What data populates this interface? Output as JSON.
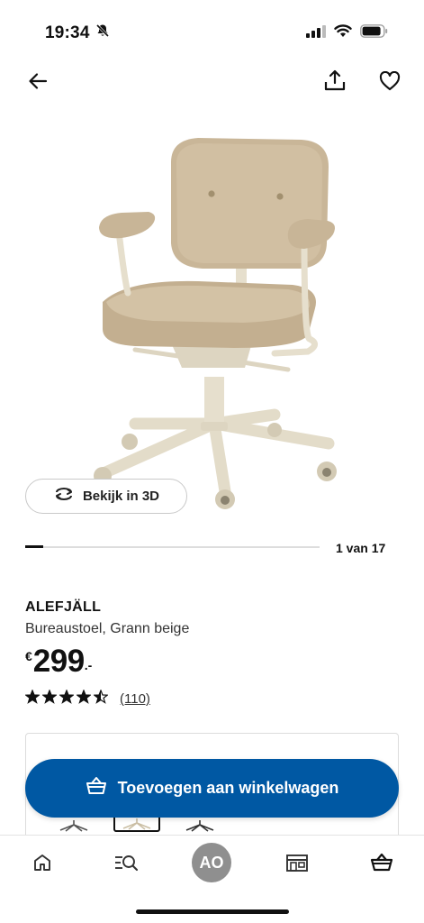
{
  "status_bar": {
    "time": "19:34"
  },
  "product": {
    "name": "ALEFJÄLL",
    "description": "Bureaustoel, Grann beige",
    "price_currency": "€",
    "price_integer": "299",
    "price_decimal": ".-",
    "rating": 4.5,
    "rating_count": "(110)"
  },
  "gallery": {
    "view_3d_label": "Bekijk in 3D",
    "counter": "1 van 17",
    "progress": 0.06
  },
  "cart": {
    "add_label": "Toevoegen aan winkelwagen"
  },
  "tab_bar": {
    "avatar_initials": "AO"
  },
  "colors": {
    "brand_blue": "#0058a3",
    "chair_beige": "#cbb89c",
    "frame_beige": "#e6dfcd"
  }
}
